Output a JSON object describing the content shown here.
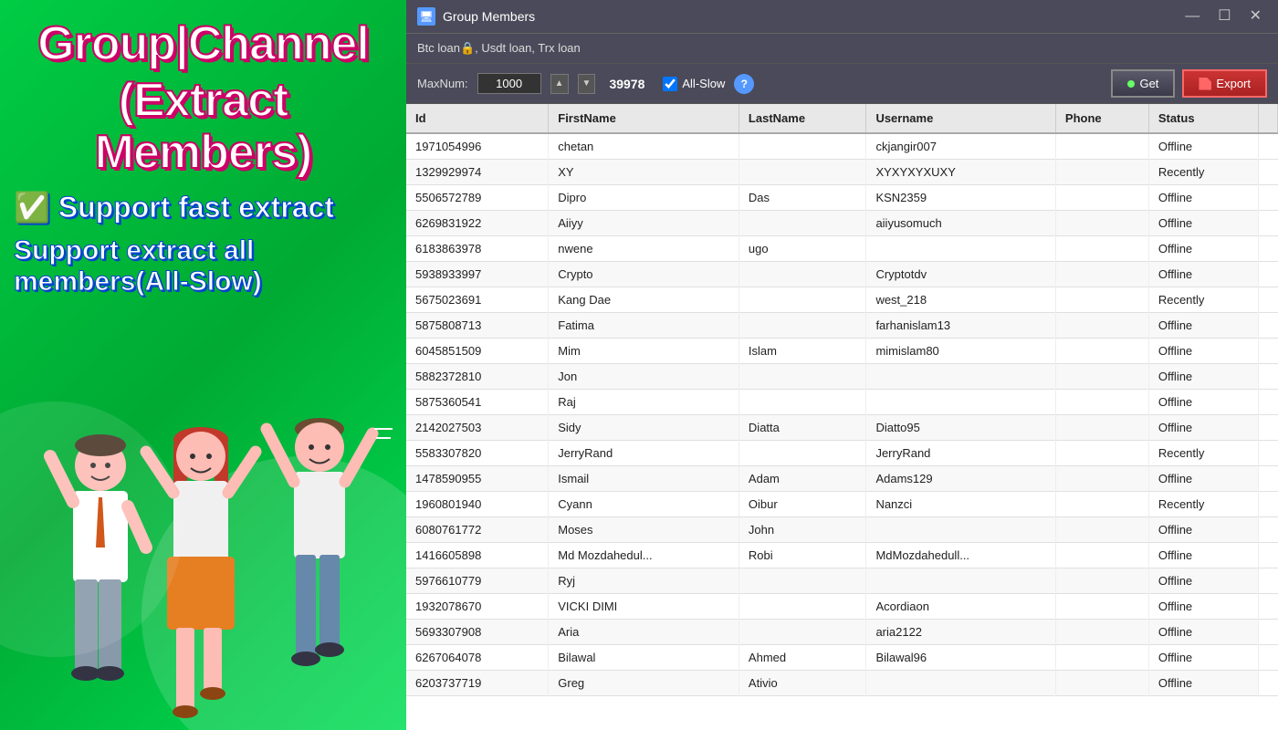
{
  "leftPanel": {
    "title1": "Group|Channel",
    "title2": "(Extract Members)",
    "feature1": "✅ Support fast extract",
    "feature2check": "✅",
    "feature2a": "Support extract all",
    "feature2b": "members(All-Slow)"
  },
  "window": {
    "icon": "🖥",
    "title": "Group Members",
    "minimizeBtn": "—",
    "maximizeBtn": "☐",
    "closeBtn": "✕"
  },
  "toolbar": {
    "sourceLabel": "Btc loan🔒, Usdt loan, Trx loan",
    "maxNumLabel": "MaxNum:",
    "maxNumValue": "1000",
    "countValue": "39978",
    "allSlowLabel": "All-Slow",
    "allSlowChecked": true,
    "getLabel": "Get",
    "exportLabel": "Export"
  },
  "table": {
    "columns": [
      "Id",
      "FirstName",
      "LastName",
      "Username",
      "Phone",
      "Status"
    ],
    "rows": [
      {
        "id": "1971054996",
        "firstName": "chetan",
        "lastName": "",
        "username": "ckjangir007",
        "phone": "",
        "status": "Offline"
      },
      {
        "id": "1329929974",
        "firstName": "XY",
        "lastName": "",
        "username": "XYXYXYXUXY",
        "phone": "",
        "status": "Recently"
      },
      {
        "id": "5506572789",
        "firstName": "Dipro",
        "lastName": "Das",
        "username": "KSN2359",
        "phone": "",
        "status": "Offline"
      },
      {
        "id": "6269831922",
        "firstName": "Aiiyy",
        "lastName": "",
        "username": "aiiyusomuch",
        "phone": "",
        "status": "Offline"
      },
      {
        "id": "6183863978",
        "firstName": "nwene",
        "lastName": "ugo",
        "username": "",
        "phone": "",
        "status": "Offline"
      },
      {
        "id": "5938933997",
        "firstName": "Crypto",
        "lastName": "",
        "username": "Cryptotdv",
        "phone": "",
        "status": "Offline"
      },
      {
        "id": "5675023691",
        "firstName": "Kang Dae",
        "lastName": "",
        "username": "west_218",
        "phone": "",
        "status": "Recently"
      },
      {
        "id": "5875808713",
        "firstName": "Fatima",
        "lastName": "",
        "username": "farhanislam13",
        "phone": "",
        "status": "Offline"
      },
      {
        "id": "6045851509",
        "firstName": "Mim",
        "lastName": "Islam",
        "username": "mimislam80",
        "phone": "",
        "status": "Offline"
      },
      {
        "id": "5882372810",
        "firstName": "Jon",
        "lastName": "",
        "username": "",
        "phone": "",
        "status": "Offline"
      },
      {
        "id": "5875360541",
        "firstName": "Raj",
        "lastName": "",
        "username": "",
        "phone": "",
        "status": "Offline"
      },
      {
        "id": "2142027503",
        "firstName": "Sidy",
        "lastName": "Diatta",
        "username": "Diatto95",
        "phone": "",
        "status": "Offline"
      },
      {
        "id": "5583307820",
        "firstName": "JerryRand",
        "lastName": "",
        "username": "JerryRand",
        "phone": "",
        "status": "Recently"
      },
      {
        "id": "1478590955",
        "firstName": "Ismail",
        "lastName": "Adam",
        "username": "Adams129",
        "phone": "",
        "status": "Offline"
      },
      {
        "id": "1960801940",
        "firstName": "Cyann",
        "lastName": "Oibur",
        "username": "Nanzci",
        "phone": "",
        "status": "Recently"
      },
      {
        "id": "6080761772",
        "firstName": "Moses",
        "lastName": "John",
        "username": "",
        "phone": "",
        "status": "Offline"
      },
      {
        "id": "1416605898",
        "firstName": "Md Mozdahedul...",
        "lastName": "Robi",
        "username": "MdMozdahedull...",
        "phone": "",
        "status": "Offline"
      },
      {
        "id": "5976610779",
        "firstName": "Ryj",
        "lastName": "",
        "username": "",
        "phone": "",
        "status": "Offline"
      },
      {
        "id": "1932078670",
        "firstName": "VICKI DIMI",
        "lastName": "",
        "username": "Acordiaon",
        "phone": "",
        "status": "Offline"
      },
      {
        "id": "5693307908",
        "firstName": "Aria",
        "lastName": "",
        "username": "aria2122",
        "phone": "",
        "status": "Offline"
      },
      {
        "id": "6267064078",
        "firstName": "Bilawal",
        "lastName": "Ahmed",
        "username": "Bilawal96",
        "phone": "",
        "status": "Offline"
      },
      {
        "id": "6203737719",
        "firstName": "Greg",
        "lastName": "Ativio",
        "username": "",
        "phone": "",
        "status": "Offline"
      }
    ]
  }
}
